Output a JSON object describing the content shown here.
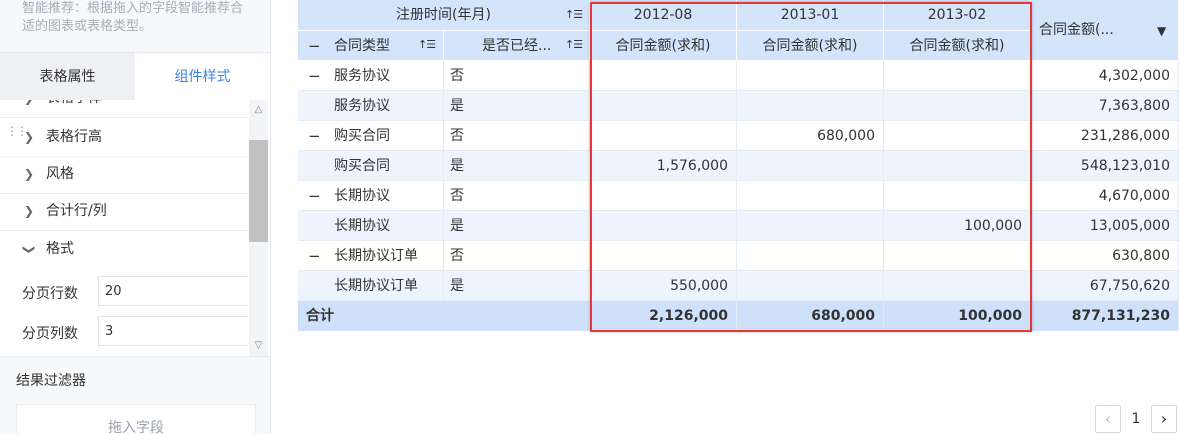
{
  "left_panel": {
    "recommend_text": "智能推荐：根据拖入的字段智能推荐合适的图表或表格类型。",
    "tabs": [
      {
        "label": "表格属性",
        "active": false
      },
      {
        "label": "组件样式",
        "active": true
      }
    ],
    "sections": [
      {
        "label": "表格字体",
        "expanded": false
      },
      {
        "label": "表格行高",
        "expanded": false
      },
      {
        "label": "风格",
        "expanded": false
      },
      {
        "label": "合计行/列",
        "expanded": false
      },
      {
        "label": "格式",
        "expanded": true
      }
    ],
    "fields": [
      {
        "label": "分页行数",
        "value": "20"
      },
      {
        "label": "分页列数",
        "value": "3"
      }
    ],
    "filter_title": "结果过滤器",
    "drop_zone_label": "拖入字段",
    "accent_color": "#3d86e6"
  },
  "table": {
    "header": {
      "row_dim_label": "注册时间(年月)",
      "col1_label": "合同类型",
      "col2_label": "是否已经...",
      "periods": [
        "2012-08",
        "2013-01",
        "2013-02"
      ],
      "measure_label": "合同金额(求和)",
      "total_col_label": "合同金额(..."
    },
    "rows": [
      {
        "type": "服务协议",
        "collapse": true,
        "flag": "否",
        "v1": "",
        "v2": "",
        "v3": "",
        "total": "4,302,000"
      },
      {
        "type": "服务协议",
        "collapse": false,
        "flag": "是",
        "v1": "",
        "v2": "",
        "v3": "",
        "total": "7,363,800"
      },
      {
        "type": "购买合同",
        "collapse": true,
        "flag": "否",
        "v1": "",
        "v2": "680,000",
        "v3": "",
        "total": "231,286,000"
      },
      {
        "type": "购买合同",
        "collapse": false,
        "flag": "是",
        "v1": "1,576,000",
        "v2": "",
        "v3": "",
        "total": "548,123,010"
      },
      {
        "type": "长期协议",
        "collapse": true,
        "flag": "否",
        "v1": "",
        "v2": "",
        "v3": "",
        "total": "4,670,000"
      },
      {
        "type": "长期协议",
        "collapse": false,
        "flag": "是",
        "v1": "",
        "v2": "",
        "v3": "100,000",
        "total": "13,005,000"
      },
      {
        "type": "长期协议订单",
        "collapse": true,
        "flag": "否",
        "v1": "",
        "v2": "",
        "v3": "",
        "total": "630,800"
      },
      {
        "type": "长期协议订单",
        "collapse": false,
        "flag": "是",
        "v1": "550,000",
        "v2": "",
        "v3": "",
        "total": "67,750,620"
      }
    ],
    "total_row": {
      "label": "合计",
      "v1": "2,126,000",
      "v2": "680,000",
      "v3": "100,000",
      "total": "877,131,230"
    },
    "colors": {
      "header_bg": "#d3e4fb",
      "odd_row_bg": "#ffffff",
      "even_row_bg": "#eef4fd",
      "total_row_bg": "#cfe0fa",
      "highlight_border": "#e5383b"
    }
  },
  "pagination": {
    "current_page": "1"
  }
}
